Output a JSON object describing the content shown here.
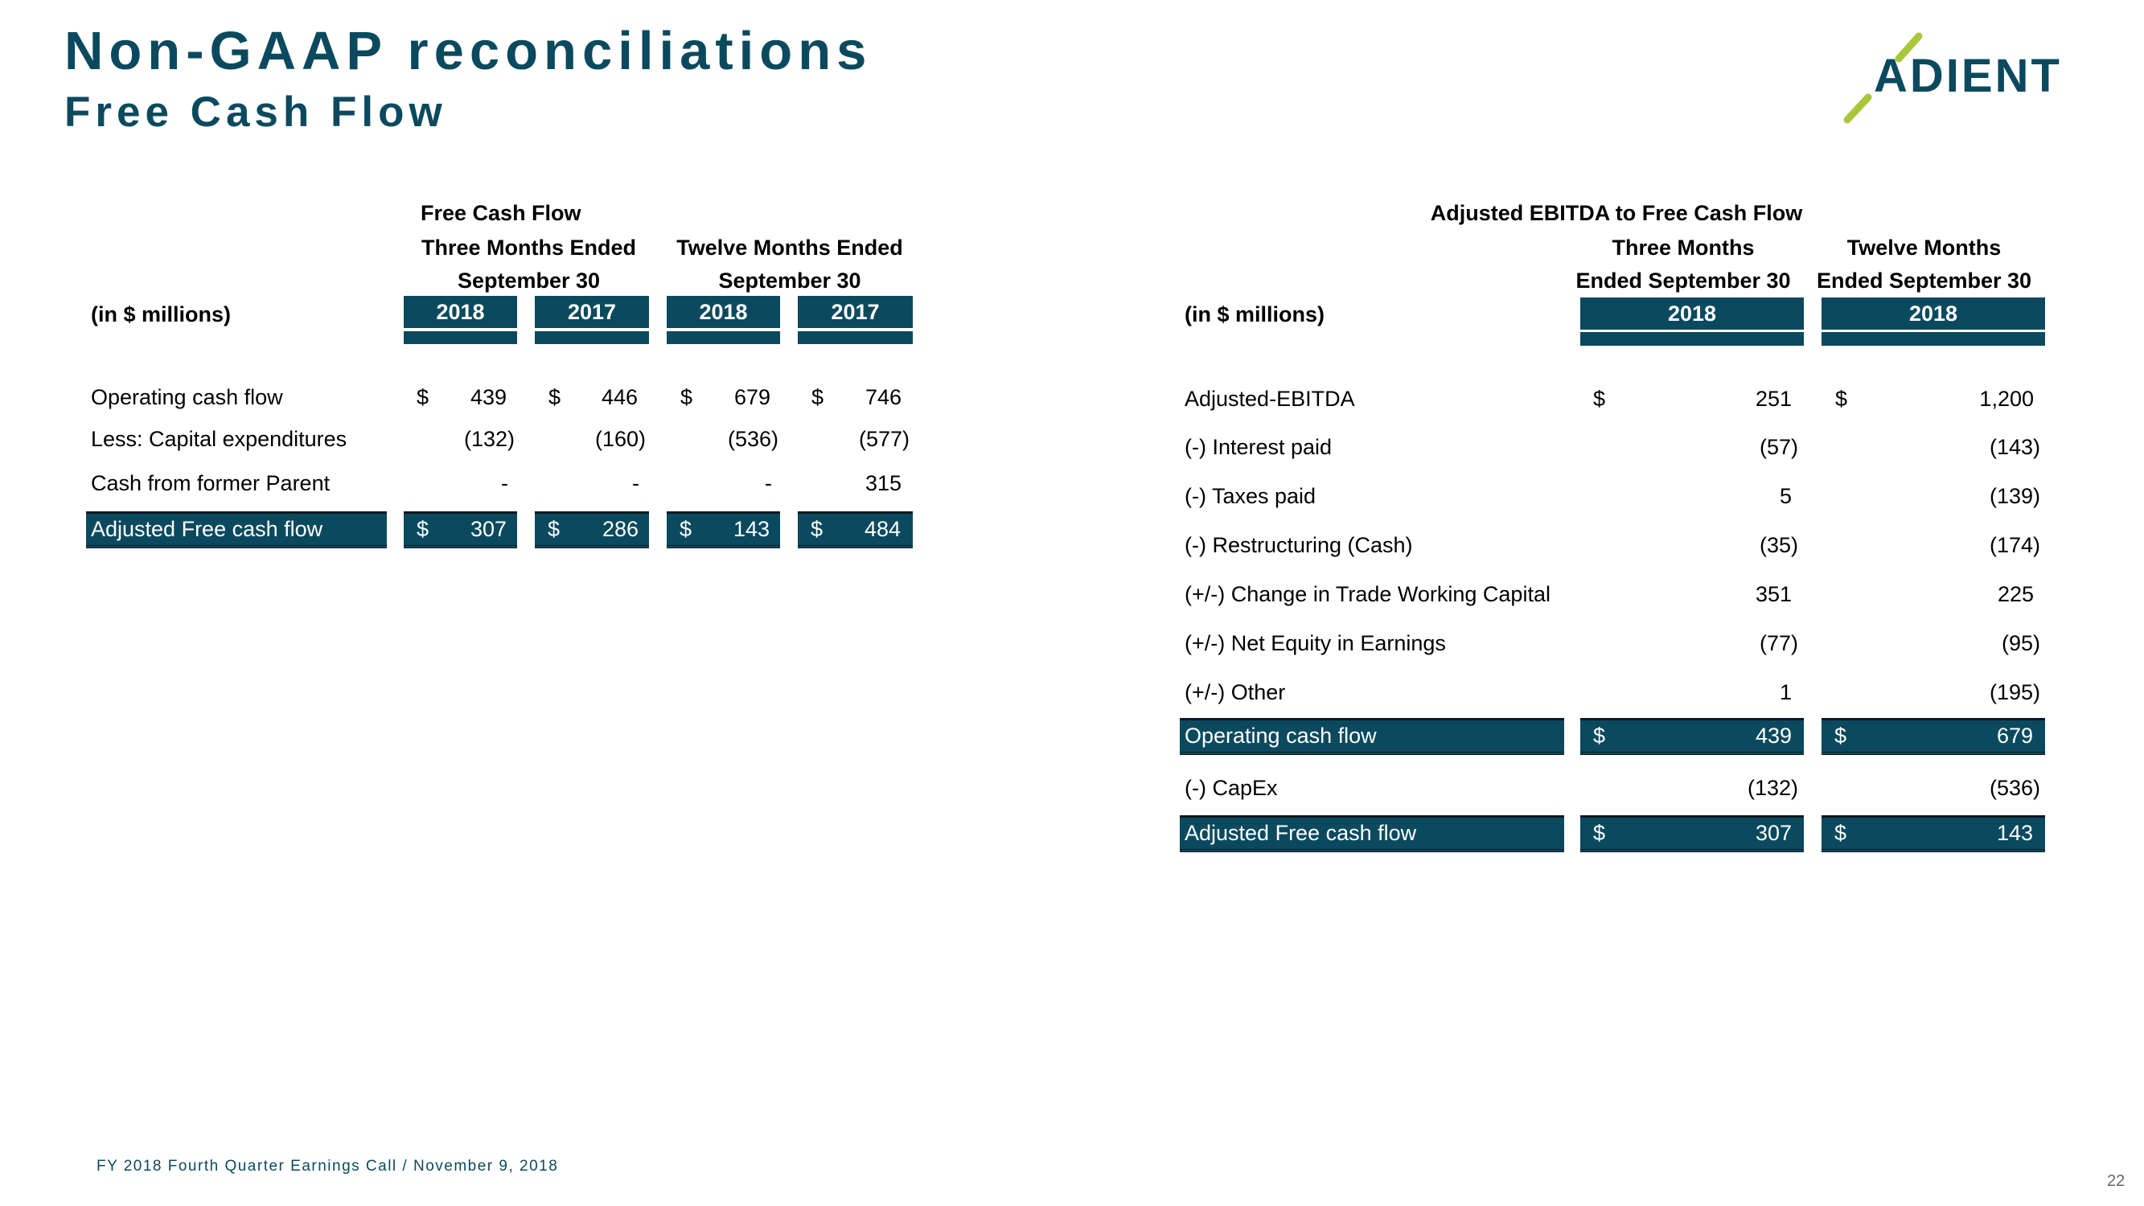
{
  "header": {
    "title": "Non-GAAP reconciliations",
    "subtitle": "Free Cash Flow",
    "logo_text": "ADIENT"
  },
  "colors": {
    "brand_teal": "#0b4a5e",
    "brand_green": "#a8c83a"
  },
  "left_table": {
    "caption": "Free Cash Flow",
    "units_label": "(in $ millions)",
    "group_headers": [
      {
        "line1": "Three Months Ended",
        "line2": "September 30"
      },
      {
        "line1": "Twelve Months Ended",
        "line2": "September 30"
      }
    ],
    "years": [
      "2018",
      "2017",
      "2018",
      "2017"
    ],
    "rows": [
      {
        "label": "Operating cash flow",
        "dollar": true,
        "values": [
          "439",
          "446",
          "679",
          "746"
        ]
      },
      {
        "label": "Less: Capital expenditures",
        "dollar": false,
        "values": [
          "(132)",
          "(160)",
          "(536)",
          "(577)"
        ]
      },
      {
        "label": "Cash from former Parent",
        "dollar": false,
        "values": [
          "-",
          "-",
          "-",
          "315"
        ]
      }
    ],
    "total": {
      "label": "Adjusted Free cash flow",
      "dollar_sign": "$",
      "values": [
        "307",
        "286",
        "143",
        "484"
      ]
    }
  },
  "right_table": {
    "caption": "Adjusted EBITDA to Free Cash Flow",
    "units_label": "(in $ millions)",
    "group_headers": [
      {
        "line1": "Three Months",
        "line2": "Ended September 30"
      },
      {
        "line1": "Twelve Months",
        "line2": "Ended September 30"
      }
    ],
    "years": [
      "2018",
      "2018"
    ],
    "rows": [
      {
        "label": "Adjusted-EBITDA",
        "dollar": true,
        "values": [
          "251",
          "1,200"
        ]
      },
      {
        "label": "(-) Interest paid",
        "dollar": false,
        "values": [
          "(57)",
          "(143)"
        ]
      },
      {
        "label": "(-) Taxes paid",
        "dollar": false,
        "values": [
          "5",
          "(139)"
        ]
      },
      {
        "label": "(-) Restructuring (Cash)",
        "dollar": false,
        "values": [
          "(35)",
          "(174)"
        ]
      },
      {
        "label": "(+/-) Change in Trade Working Capital",
        "dollar": false,
        "values": [
          "351",
          "225"
        ]
      },
      {
        "label": "(+/-) Net Equity in Earnings",
        "dollar": false,
        "values": [
          "(77)",
          "(95)"
        ]
      },
      {
        "label": "(+/-) Other",
        "dollar": false,
        "values": [
          "1",
          "(195)"
        ]
      }
    ],
    "subtotal": {
      "label": "Operating cash flow",
      "dollar_sign": "$",
      "values": [
        "439",
        "679"
      ]
    },
    "capex": {
      "label": "(-) CapEx",
      "values": [
        "(132)",
        "(536)"
      ]
    },
    "total": {
      "label": "Adjusted Free cash flow",
      "dollar_sign": "$",
      "values": [
        "307",
        "143"
      ]
    }
  },
  "footer": {
    "text": "FY 2018 Fourth Quarter Earnings Call / November 9, 2018",
    "page_number": "22"
  }
}
